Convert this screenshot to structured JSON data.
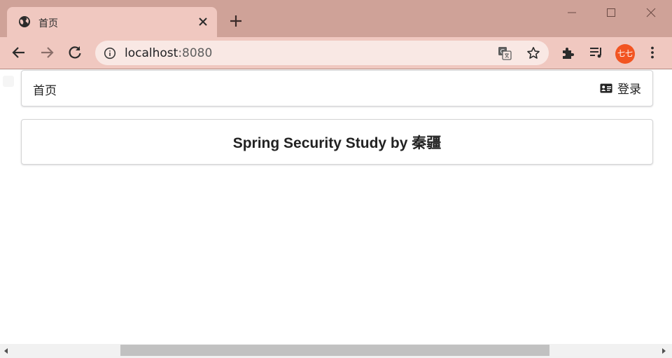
{
  "browser": {
    "tab": {
      "title": "首页",
      "favicon": "globe-icon"
    },
    "address": {
      "host": "localhost",
      "port": ":8080"
    },
    "profile": {
      "label": "七七",
      "color": "#f25421"
    },
    "colors": {
      "tabstrip": "#cfa298",
      "toolbar": "#f0c8c0",
      "omnibox": "#f9e8e4"
    }
  },
  "nav": {
    "home_label": "首页",
    "login_label": "登录",
    "login_icon": "id-card-icon"
  },
  "main": {
    "heading": "Spring Security Study by 秦疆"
  }
}
